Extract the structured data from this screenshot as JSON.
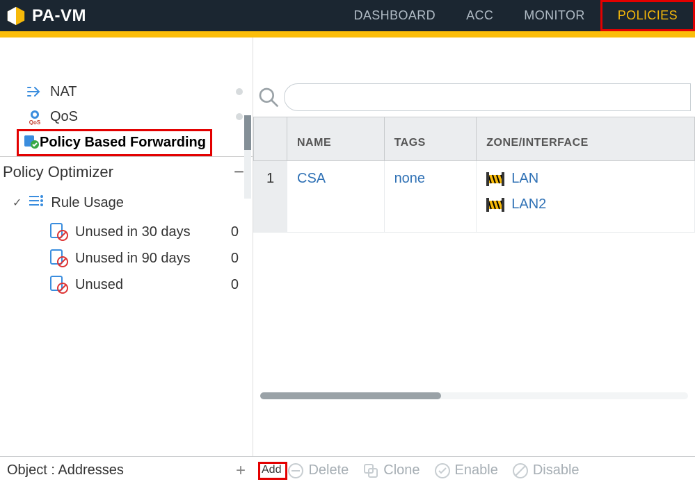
{
  "app_title": "PA-VM",
  "nav": {
    "dashboard": "DASHBOARD",
    "acc": "ACC",
    "monitor": "MONITOR",
    "policies": "POLICIES"
  },
  "sidebar": {
    "nat": "NAT",
    "qos": "QoS",
    "pbf": "Policy Based Forwarding",
    "policy_optimizer": "Policy Optimizer",
    "rule_usage": "Rule Usage",
    "unused30": {
      "label": "Unused in 30 days",
      "count": "0"
    },
    "unused90": {
      "label": "Unused in 90 days",
      "count": "0"
    },
    "unused": {
      "label": "Unused",
      "count": "0"
    }
  },
  "search": {
    "placeholder": ""
  },
  "table": {
    "headers": {
      "name": "NAME",
      "tags": "TAGS",
      "zone": "ZONE/INTERFACE"
    },
    "row1": {
      "num": "1",
      "name": "CSA",
      "tags": "none",
      "zone1": "LAN",
      "zone2": "LAN2"
    }
  },
  "bottom_left": {
    "label": "Object : Addresses"
  },
  "actions": {
    "add": "Add",
    "delete": "Delete",
    "clone": "Clone",
    "enable": "Enable",
    "disable": "Disable"
  }
}
